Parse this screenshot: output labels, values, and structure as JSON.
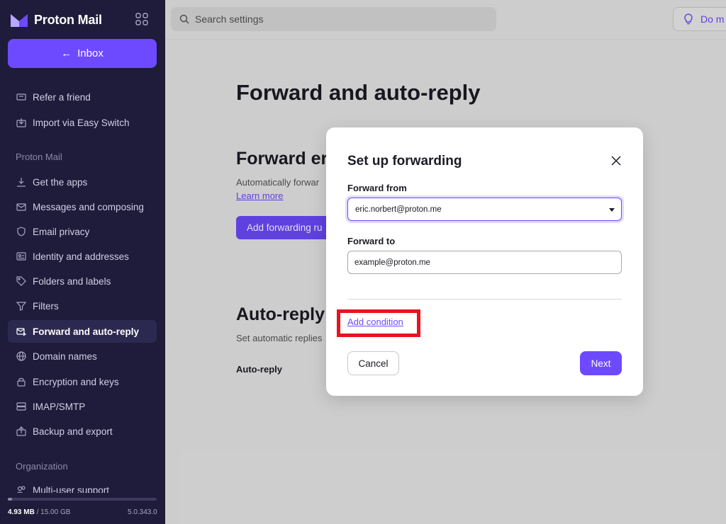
{
  "app": {
    "brand_name": "Proton Mail",
    "back_button_label": "Inbox"
  },
  "sidebar": {
    "top_items": [
      {
        "label": "Refer a friend",
        "icon": "gift-card-icon"
      },
      {
        "label": "Import via Easy Switch",
        "icon": "import-icon"
      }
    ],
    "section_mail": "Proton Mail",
    "mail_items": [
      {
        "label": "Get the apps",
        "icon": "download-icon"
      },
      {
        "label": "Messages and composing",
        "icon": "envelope-icon"
      },
      {
        "label": "Email privacy",
        "icon": "shield-icon"
      },
      {
        "label": "Identity and addresses",
        "icon": "id-card-icon"
      },
      {
        "label": "Folders and labels",
        "icon": "tag-icon"
      },
      {
        "label": "Filters",
        "icon": "filter-icon"
      },
      {
        "label": "Forward and auto-reply",
        "icon": "envelope-forward-icon",
        "active": true
      },
      {
        "label": "Domain names",
        "icon": "globe-icon"
      },
      {
        "label": "Encryption and keys",
        "icon": "lock-icon"
      },
      {
        "label": "IMAP/SMTP",
        "icon": "servers-icon"
      },
      {
        "label": "Backup and export",
        "icon": "export-icon"
      }
    ],
    "section_org": "Organization",
    "org_items": [
      {
        "label": "Multi-user support",
        "icon": "users-icon"
      }
    ],
    "storage": {
      "used": "4.93 MB",
      "separator": " / ",
      "total": "15.00 GB",
      "used_fraction": 0.0003
    },
    "version": "5.0.343.0"
  },
  "topbar": {
    "search_placeholder": "Search settings",
    "tip_button_label": "Do m"
  },
  "main": {
    "page_title": "Forward and auto-reply",
    "forward_heading": "Forward er",
    "forward_description": "Automatically forwar",
    "learn_more": "Learn more",
    "add_rule_button": "Add forwarding ru",
    "autoreply_heading": "Auto-reply",
    "autoreply_description": "Set automatic replies",
    "autoreply_label": "Auto-reply"
  },
  "modal": {
    "title": "Set up forwarding",
    "forward_from_label": "Forward from",
    "forward_from_value": "eric.norbert@proton.me",
    "forward_to_label": "Forward to",
    "forward_to_placeholder": "example@proton.me",
    "add_condition": "Add condition",
    "cancel_label": "Cancel",
    "next_label": "Next"
  },
  "colors": {
    "sidebar_bg": "#1e1b3b",
    "accent": "#6d4aff",
    "highlight": "#e8131f"
  }
}
